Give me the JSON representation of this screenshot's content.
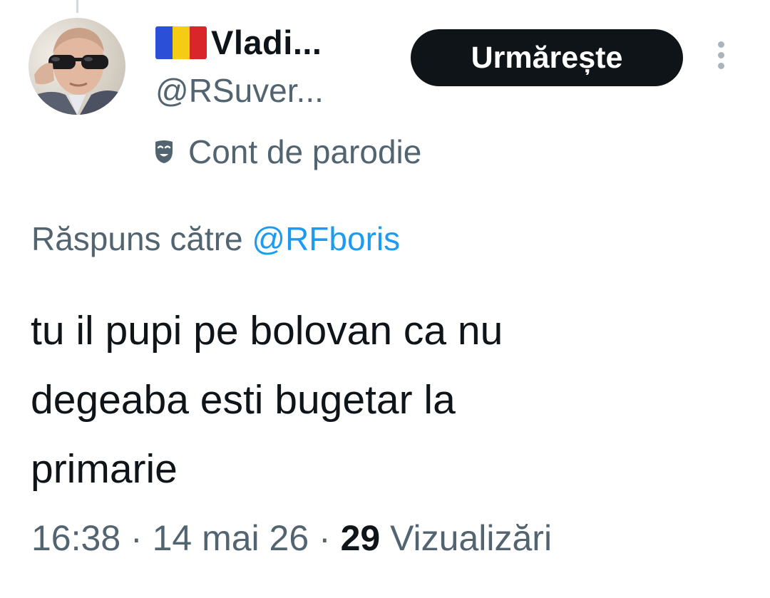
{
  "author": {
    "flag_colors": [
      "#2b4fd6",
      "#f5cc14",
      "#d9262b"
    ],
    "display_name": "Vladi...",
    "handle": "@RSuver...",
    "parody_icon": "theater-mask-icon",
    "parody_label": "Cont de parodie",
    "avatar_icon": "avatar-photo"
  },
  "actions": {
    "follow_label": "Urmărește",
    "more_icon": "more-vertical-icon"
  },
  "reply": {
    "prefix": "Răspuns către ",
    "mention": "@RFboris"
  },
  "tweet": {
    "lines": [
      "tu il pupi pe bolovan ca nu",
      "degeaba esti bugetar la",
      "primarie"
    ]
  },
  "meta": {
    "time": "16:38",
    "separator": " · ",
    "date": "14 mai 26",
    "views_count": "29",
    "views_label": " Vizualizări"
  },
  "colors": {
    "accent": "#1d9bf0",
    "secondary_text": "#536471",
    "primary_text": "#0f1419",
    "button_bg": "#0f1419"
  }
}
